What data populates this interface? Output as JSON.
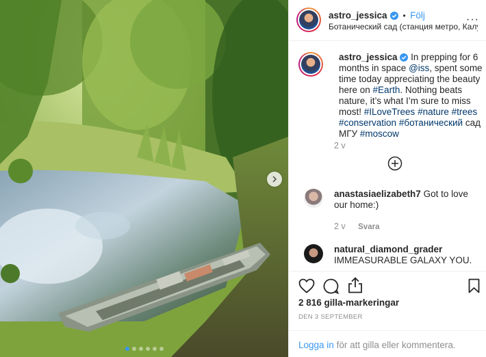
{
  "post": {
    "author": "astro_jessica",
    "follow_label": "Följ",
    "separator": "•",
    "location": "Ботанический сад (станция метро, Калу…",
    "more_label": "···",
    "caption_parts": [
      {
        "text": "In prepping for 6 months in space ",
        "tag": false
      },
      {
        "text": "@iss",
        "tag": true
      },
      {
        "text": ", spent some time today appreciating the beauty here on ",
        "tag": false
      },
      {
        "text": "#Earth",
        "tag": true
      },
      {
        "text": ". Nothing beats nature, it’s what I’m sure to miss most! ",
        "tag": false
      },
      {
        "text": "#ILoveTrees",
        "tag": true
      },
      {
        "text": " ",
        "tag": false
      },
      {
        "text": "#nature",
        "tag": true
      },
      {
        "text": " ",
        "tag": false
      },
      {
        "text": "#trees",
        "tag": true
      },
      {
        "text": " ",
        "tag": false
      },
      {
        "text": "#conservation",
        "tag": true
      },
      {
        "text": " ",
        "tag": false
      },
      {
        "text": "#ботанический",
        "tag": true
      },
      {
        "text": " сад МГУ ",
        "tag": false
      },
      {
        "text": "#moscow",
        "tag": true
      }
    ],
    "caption_time": "2 v",
    "likes": "2 816 gilla-markeringar",
    "date": "DEN 3 SEPTEMBER"
  },
  "comments": [
    {
      "author": "anastasiaelizabeth7",
      "text": "Got to love our home:)",
      "time": "2 v",
      "reply_label": "Svara"
    },
    {
      "author": "natural_diamond_grader",
      "text": "IMMEASURABLE GALAXY YOU."
    }
  ],
  "footer": {
    "login_link": "Logga in",
    "login_text": " för att gilla eller kommentera."
  },
  "carousel": {
    "slide_count": 6,
    "active_index": 0
  },
  "icons": {
    "verified": "verified-badge-icon",
    "load_more": "plus-circle-icon",
    "like": "heart-icon",
    "comment": "comment-icon",
    "share": "share-icon",
    "save": "bookmark-icon",
    "next": "chevron-right-icon"
  },
  "colors": {
    "link": "#3897f0",
    "tag": "#00376b",
    "muted": "#8e8e8e",
    "text": "#262626"
  }
}
